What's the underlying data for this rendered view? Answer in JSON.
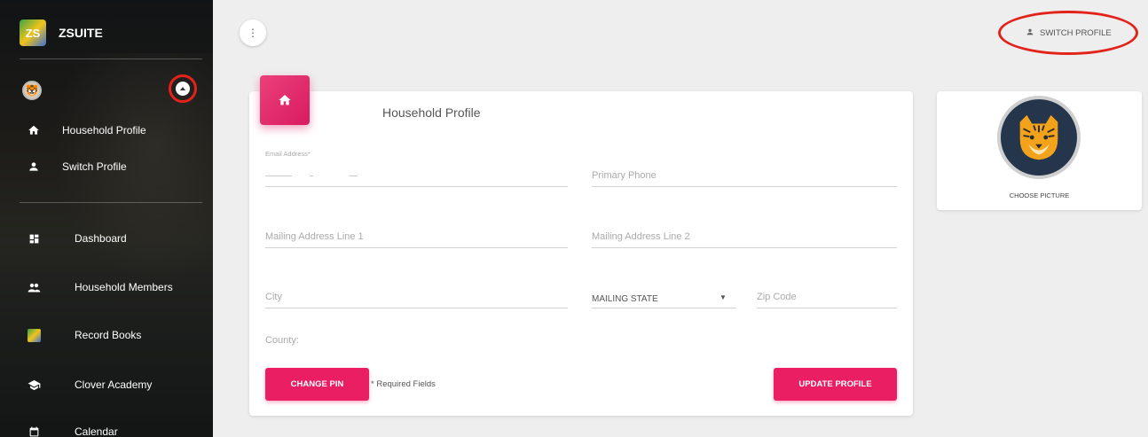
{
  "sidebar": {
    "brand": "ZSUITE",
    "brand_logo": "ZS",
    "items": [
      {
        "label": "Household Profile",
        "icon": "home-icon"
      },
      {
        "label": "Switch Profile",
        "icon": "person-icon"
      },
      {
        "label": "Dashboard",
        "icon": "dashboard-icon"
      },
      {
        "label": "Household Members",
        "icon": "people-icon"
      },
      {
        "label": "Record Books",
        "icon": "zsuite-logo-icon"
      },
      {
        "label": "Clover Academy",
        "icon": "school-icon"
      },
      {
        "label": "Calendar",
        "icon": "calendar-icon"
      }
    ]
  },
  "header": {
    "switch_profile": "SWITCH PROFILE"
  },
  "form": {
    "title": "Household Profile",
    "email_label": "Email Address*",
    "primary_phone_placeholder": "Primary Phone",
    "mailing_1_placeholder": "Mailing Address Line 1",
    "mailing_2_placeholder": "Mailing Address Line 2",
    "city_placeholder": "City",
    "state_selected": "MAILING STATE",
    "zip_placeholder": "Zip Code",
    "county_placeholder": "County:",
    "change_pin": "CHANGE PIN",
    "required_note": "* Required Fields",
    "update_profile": "UPDATE PROFILE"
  },
  "picture": {
    "choose_label": "CHOOSE PICTURE"
  },
  "colors": {
    "accent": "#e91e63",
    "annotation": "#e2231a"
  }
}
